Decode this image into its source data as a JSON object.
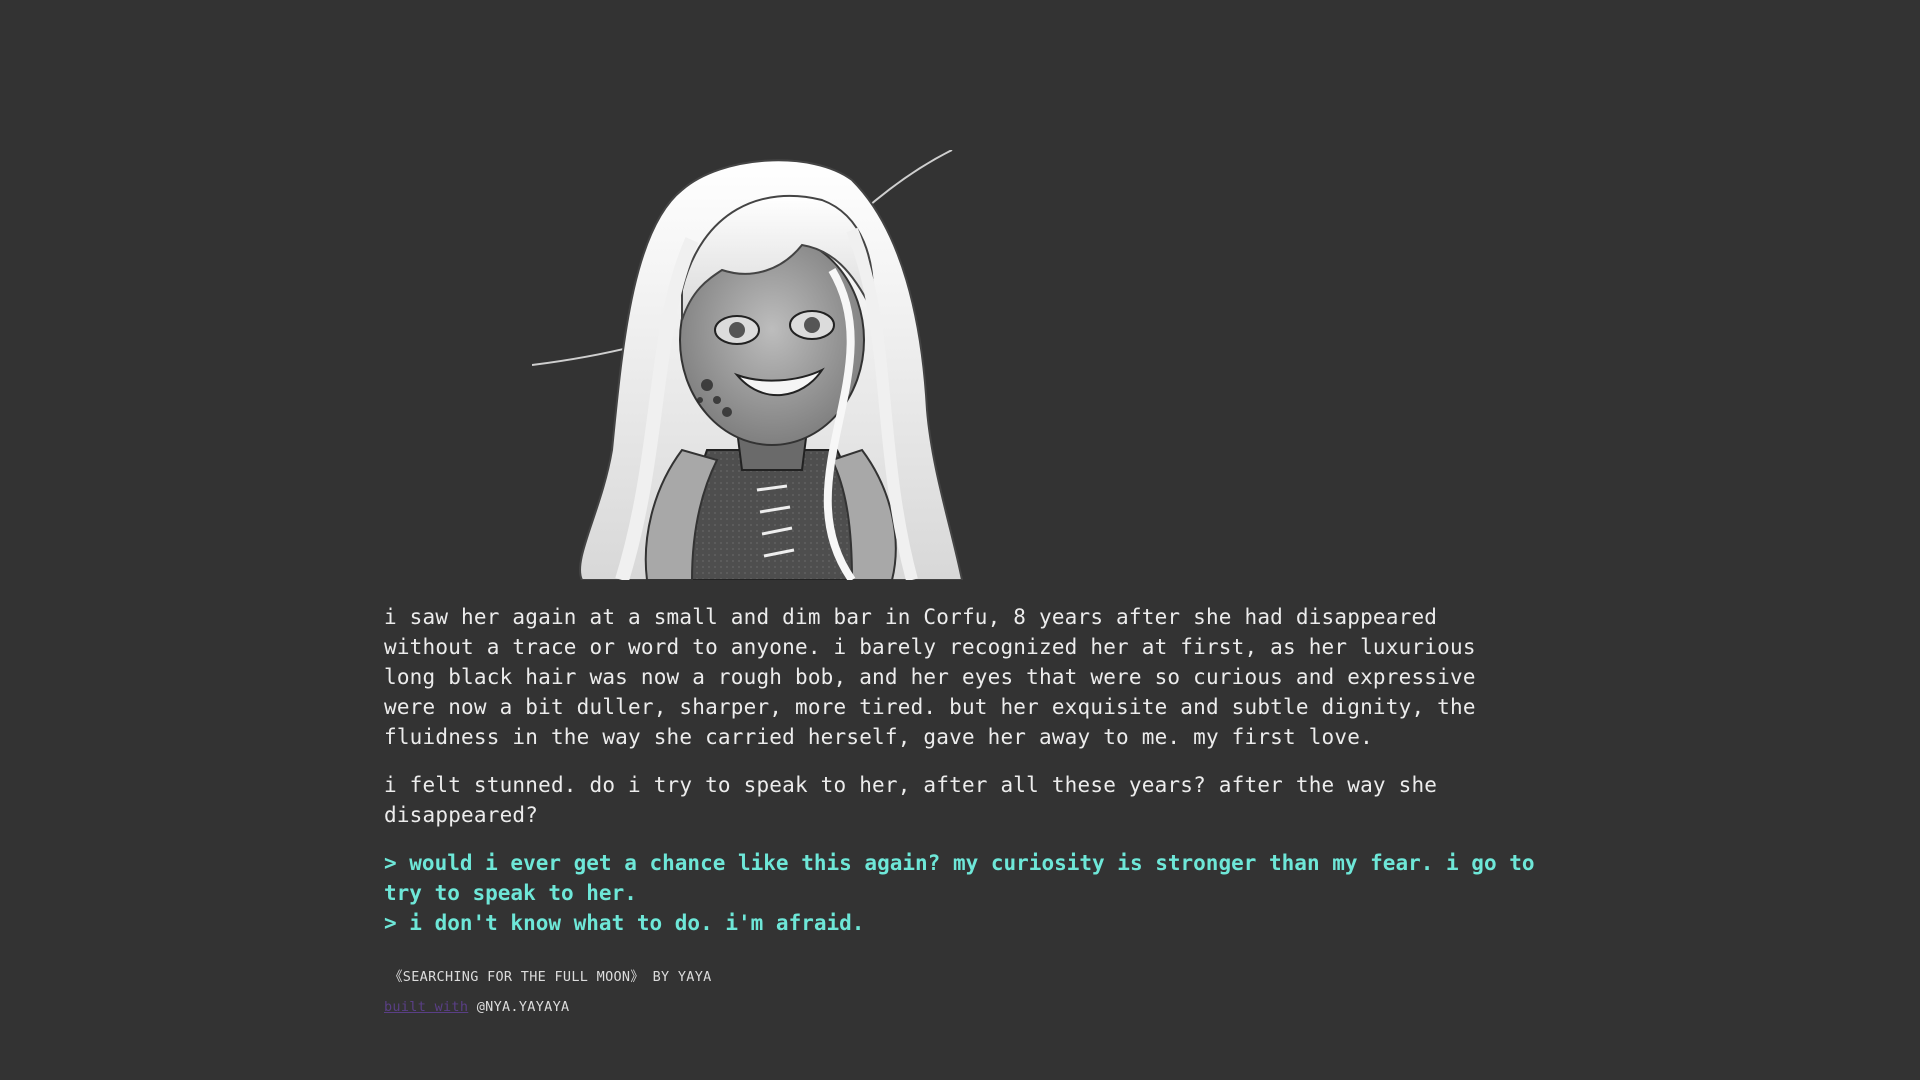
{
  "story": {
    "paragraphs": [
      "i saw her again at a small and dim bar in Corfu, 8 years after she had disappeared without a trace or word to anyone. i barely recognized her at first, as her luxurious long black hair was now a rough bob, and her eyes that were so curious and expressive were now a bit duller, sharper, more tired. but her exquisite and subtle dignity, the fluidness in the way she carried herself, gave her away to me. my first love.",
      "i felt stunned. do i try to speak to her, after all these years? after the way she disappeared?"
    ],
    "choices": [
      "> would i ever get a chance like this again? my curiosity is stronger than my fear. i go to try to speak to her.",
      "> i don't know what to do. i'm afraid."
    ]
  },
  "credits": {
    "title_line": "《SEARCHING FOR THE FULL MOON》 BY YAYA",
    "engine_link": "built with",
    "handle": "@NYA.YAYAYA"
  },
  "colors": {
    "background": "#333333",
    "text": "#ececec",
    "choice": "#6ee7d8",
    "link": "#5a3f86"
  },
  "icons": {
    "illustration": "grayscale-anime-girl-portrait"
  }
}
